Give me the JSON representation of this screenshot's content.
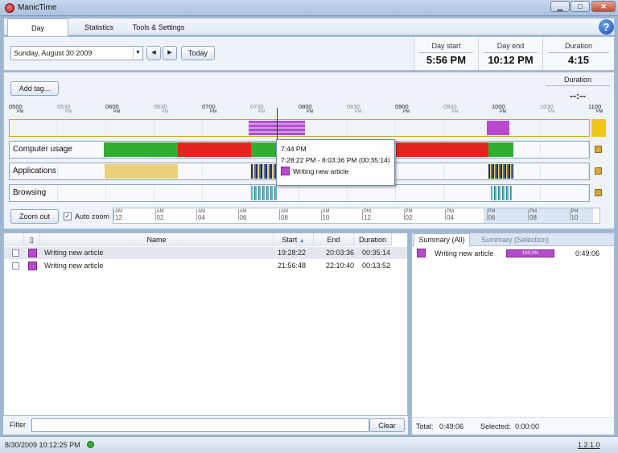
{
  "app": {
    "title": "ManicTime",
    "version": "1.2.1.0"
  },
  "window": {
    "minimize": "▁",
    "maximize": "□",
    "close": "✕"
  },
  "tabs": [
    {
      "label": "Day"
    },
    {
      "label": "Statistics"
    },
    {
      "label": "Tools & Settings"
    }
  ],
  "help": "?",
  "date": {
    "value": "Sunday, August 30 2009",
    "prev": "◀",
    "next": "▶",
    "today": "Today"
  },
  "stats": {
    "day_start_label": "Day start",
    "day_start": "5:56 PM",
    "day_end_label": "Day end",
    "day_end": "10:12 PM",
    "duration_label": "Duration",
    "duration": "4:15",
    "sel_duration_label": "Duration",
    "sel_duration": "--:--"
  },
  "add_tag": "Add tag...",
  "ruler": [
    "0500",
    "0530",
    "0600",
    "0630",
    "0700",
    "0730",
    "0800",
    "0830",
    "0900",
    "0930",
    "1000",
    "1030",
    "1100"
  ],
  "ruler_pm": "PM",
  "rows": {
    "computer": "Computer usage",
    "apps": "Applications",
    "browsing": "Browsing"
  },
  "tooltip": {
    "time": "7:44 PM",
    "range": "7:28:22 PM - 8:03:36 PM (00:35:14)",
    "title": "Writing new article"
  },
  "zoom": {
    "out": "Zoom out",
    "auto": "Auto zoom"
  },
  "overview": [
    [
      "AM",
      "12"
    ],
    [
      "AM",
      "02"
    ],
    [
      "AM",
      "04"
    ],
    [
      "AM",
      "06"
    ],
    [
      "AM",
      "08"
    ],
    [
      "AM",
      "10"
    ],
    [
      "PM",
      "12"
    ],
    [
      "PM",
      "02"
    ],
    [
      "PM",
      "04"
    ],
    [
      "PM",
      "06"
    ],
    [
      "PM",
      "08"
    ],
    [
      "PM",
      "10"
    ]
  ],
  "grid": {
    "headers": {
      "name": "Name",
      "start": "Start",
      "end": "End",
      "duration": "Duration"
    },
    "rows": [
      {
        "name": "Writing new article",
        "start": "19:28:22",
        "end": "20:03:36",
        "duration": "00:35:14"
      },
      {
        "name": "Writing new article",
        "start": "21:56:48",
        "end": "22:10:40",
        "duration": "00:13:52"
      }
    ]
  },
  "summary": {
    "tab_all": "Summary (All)",
    "tab_selection": "Summary (Selection)",
    "item": "Writing new article",
    "percent": "100.0%",
    "percent_value": 1.0,
    "time": "0:49:06",
    "total_label": "Total:",
    "total": "0:49:06",
    "selected_label": "Selected:",
    "selected": "0:00:00"
  },
  "filter": {
    "label": "Filter",
    "clear": "Clear"
  },
  "status": {
    "datetime": "8/30/2009 10:12:25 PM"
  },
  "colors": {
    "tag": "#b84ad0",
    "active": "#2fae2f",
    "away": "#e0261c",
    "app_yellow": "#e9d27a",
    "accent": "#f1c41a"
  }
}
